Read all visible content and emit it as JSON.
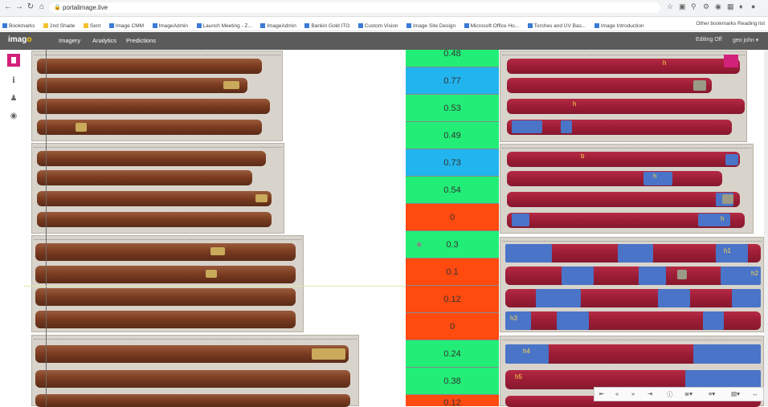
{
  "browser": {
    "url": "portalimage.live",
    "bookmarks": [
      "Bookmarks",
      "2nd Shade",
      "Sent",
      "Image CMM",
      "ImageAdmin",
      "Launch Meeting - Z...",
      "ImageAdmin",
      "Bankin Gold ITO",
      "Custom Vision",
      "Image Site Design",
      "Microsoft Office Ho...",
      "Torches and UV Bas...",
      "Image Introduction"
    ],
    "bookmarks_right": "Other bookmarks  Reading list"
  },
  "app": {
    "logo_main": "imag",
    "logo_accent": "o",
    "nav": [
      "Imagery",
      "Analytics",
      "Predictions"
    ],
    "editing": "Editing Off",
    "user": "geo john ▾"
  },
  "scores": [
    {
      "value": "0.48",
      "color": "#22ee77"
    },
    {
      "value": "0.77",
      "color": "#22b4ee"
    },
    {
      "value": "0.53",
      "color": "#22ee77"
    },
    {
      "value": "0.49",
      "color": "#22ee77"
    },
    {
      "value": "0.73",
      "color": "#22b4ee"
    },
    {
      "value": "0.54",
      "color": "#22ee77"
    },
    {
      "value": "0",
      "color": "#ff4a10"
    },
    {
      "value": "0.3",
      "color": "#22ee77"
    },
    {
      "value": "0.1",
      "color": "#ff4a10"
    },
    {
      "value": "0.12",
      "color": "#ff4a10"
    },
    {
      "value": "0",
      "color": "#ff4a10"
    },
    {
      "value": "0.24",
      "color": "#22ee77"
    },
    {
      "value": "0.38",
      "color": "#22ee77"
    },
    {
      "value": "0.12",
      "color": "#ff4a10"
    }
  ],
  "tags": [
    "h",
    "h",
    "b",
    "h",
    "h",
    "h",
    "h",
    "h1",
    "h2",
    "h3",
    "h4",
    "h5"
  ],
  "bottom_toolbar": [
    "⇤",
    "«",
    "»",
    "⇥",
    "ⓘ",
    "≣▾",
    "≡▾",
    "▤▾",
    "↔"
  ]
}
